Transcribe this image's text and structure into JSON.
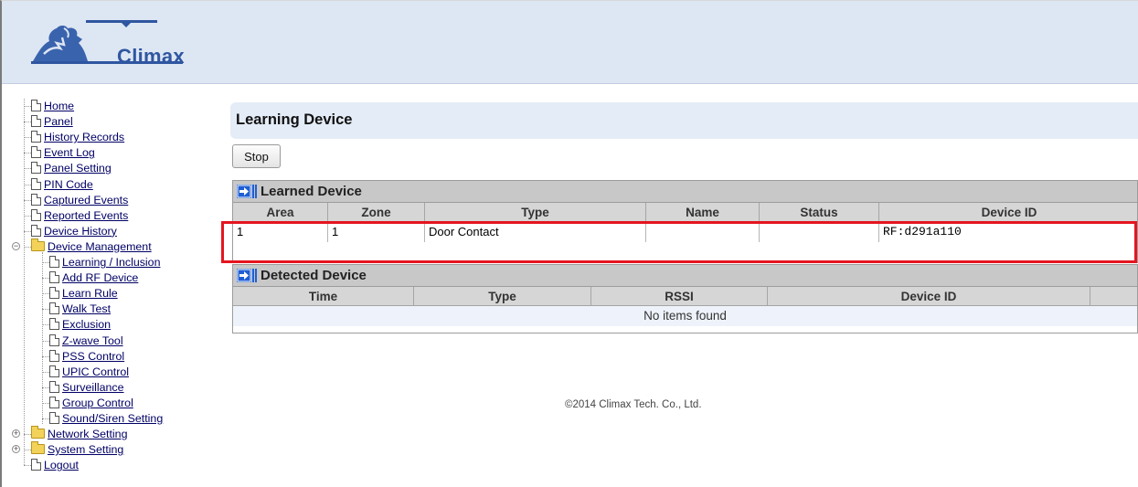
{
  "brand": {
    "name": "Climax",
    "color": "#2f56a0"
  },
  "sidebar": {
    "items": [
      {
        "label": "Home",
        "icon": "document-icon"
      },
      {
        "label": "Panel",
        "icon": "document-icon"
      },
      {
        "label": "History Records",
        "icon": "document-icon"
      },
      {
        "label": "Event Log",
        "icon": "document-icon"
      },
      {
        "label": "Panel Setting",
        "icon": "document-icon"
      },
      {
        "label": "PIN Code",
        "icon": "document-icon"
      },
      {
        "label": "Captured Events",
        "icon": "document-icon"
      },
      {
        "label": "Reported Events",
        "icon": "document-icon"
      },
      {
        "label": "Device History",
        "icon": "document-icon"
      },
      {
        "label": "Device Management",
        "icon": "folder-open-icon",
        "expanded": true
      },
      {
        "label": "Learning / Inclusion",
        "icon": "document-icon"
      },
      {
        "label": "Add RF Device",
        "icon": "document-icon"
      },
      {
        "label": "Learn Rule",
        "icon": "document-icon"
      },
      {
        "label": "Walk Test",
        "icon": "document-icon"
      },
      {
        "label": "Exclusion",
        "icon": "document-icon"
      },
      {
        "label": "Z-wave Tool",
        "icon": "document-icon"
      },
      {
        "label": "PSS Control",
        "icon": "document-icon"
      },
      {
        "label": "UPIC Control",
        "icon": "document-icon"
      },
      {
        "label": "Surveillance",
        "icon": "document-icon"
      },
      {
        "label": "Group Control",
        "icon": "document-icon"
      },
      {
        "label": "Sound/Siren Setting",
        "icon": "document-icon"
      },
      {
        "label": "Network Setting",
        "icon": "folder-icon",
        "expanded": false
      },
      {
        "label": "System Setting",
        "icon": "folder-icon",
        "expanded": false
      },
      {
        "label": "Logout",
        "icon": "document-icon"
      }
    ]
  },
  "main": {
    "title": "Learning Device",
    "stop_label": "Stop",
    "learned": {
      "title": "Learned Device",
      "columns": [
        "Area",
        "Zone",
        "Type",
        "Name",
        "Status",
        "Device ID"
      ],
      "rows": [
        {
          "area": "1",
          "zone": "1",
          "type": "Door Contact",
          "name": "",
          "status": "",
          "device_id": "RF:d291a110"
        }
      ]
    },
    "detected": {
      "title": "Detected Device",
      "columns": [
        "Time",
        "Type",
        "RSSI",
        "Device ID"
      ],
      "empty_text": "No items found"
    }
  },
  "footer": {
    "text": "©2014 Climax Tech. Co., Ltd."
  },
  "colors": {
    "highlight": "#e4151f",
    "header_bg": "#dde6f3",
    "panel_head": "#c8c8c8",
    "link": "#000066"
  }
}
